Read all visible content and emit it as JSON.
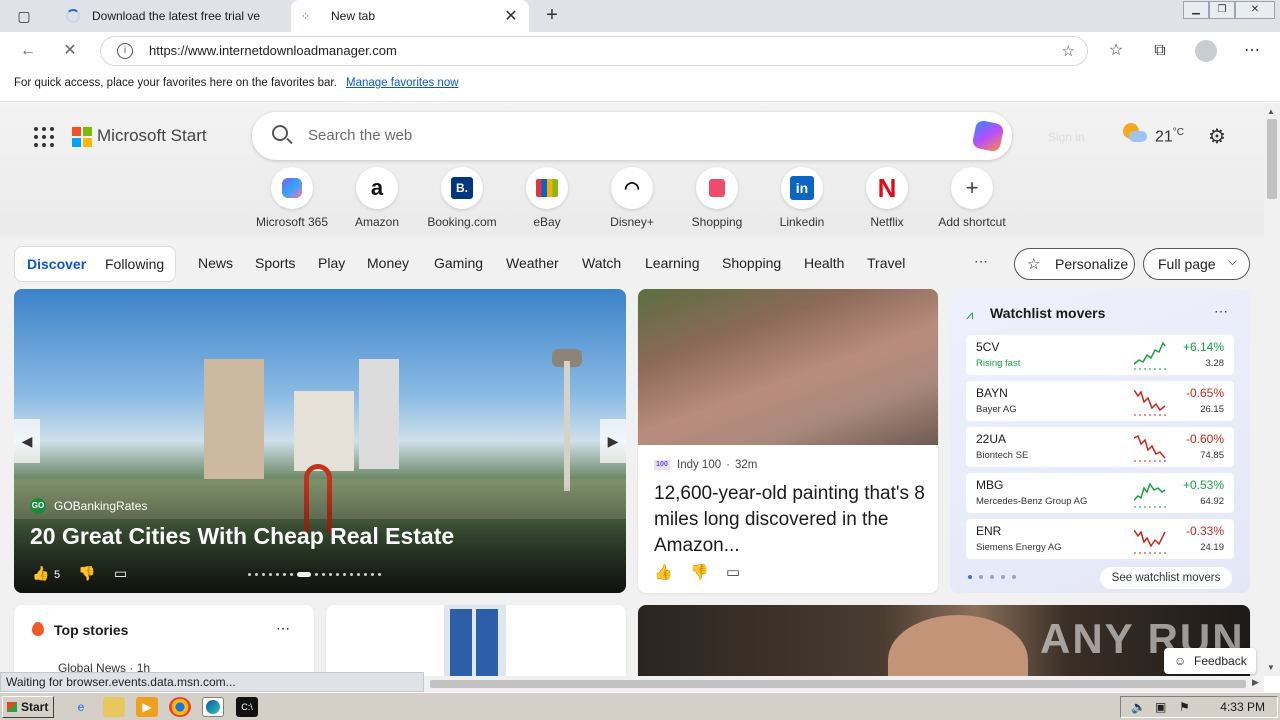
{
  "browser": {
    "tabs": [
      {
        "title": "Download the latest free trial ve"
      },
      {
        "title": "New tab"
      }
    ],
    "url": "https://www.internetdownloadmanager.com",
    "favorites_bar": {
      "text": "For quick access, place your favorites here on the favorites bar.",
      "link": "Manage favorites now"
    },
    "status": "Waiting for browser.events.data.msn.com..."
  },
  "header": {
    "brand": "Microsoft Start",
    "search_placeholder": "Search the web",
    "signin": "Sign in",
    "temperature": "21",
    "temp_unit": "°C"
  },
  "shortcuts": [
    {
      "label": "Microsoft 365",
      "icon": "microsoft-365-icon"
    },
    {
      "label": "Amazon",
      "icon": "amazon-icon"
    },
    {
      "label": "Booking.com",
      "icon": "booking-icon"
    },
    {
      "label": "eBay",
      "icon": "ebay-icon"
    },
    {
      "label": "Disney+",
      "icon": "disney-plus-icon"
    },
    {
      "label": "Shopping",
      "icon": "shopping-bag-icon"
    },
    {
      "label": "Linkedin",
      "icon": "linkedin-icon"
    },
    {
      "label": "Netflix",
      "icon": "netflix-icon"
    },
    {
      "label": "Add shortcut",
      "icon": "plus-icon"
    }
  ],
  "feed": {
    "tabs": [
      "Discover",
      "Following"
    ],
    "categories": [
      "News",
      "Sports",
      "Play",
      "Money",
      "Gaming",
      "Weather",
      "Watch",
      "Learning",
      "Shopping",
      "Health",
      "Travel"
    ],
    "personalize": "Personalize",
    "layout": "Full page"
  },
  "hero": {
    "source": "GOBankingRates",
    "headline": "20 Great Cities With Cheap Real Estate",
    "likes": "5"
  },
  "story": {
    "source": "Indy 100",
    "age": "32m",
    "headline": "12,600-year-old painting that's 8 miles long discovered in the Amazon..."
  },
  "watchlist": {
    "title": "Watchlist movers",
    "see_all": "See watchlist movers",
    "stocks": [
      {
        "symbol": "5CV",
        "name": "Rising fast",
        "change": "+6.14%",
        "price": "3.28",
        "color": "#1a9b4a"
      },
      {
        "symbol": "BAYN",
        "name": "Bayer AG",
        "change": "-0.65%",
        "price": "26.15",
        "color": "#c5281c"
      },
      {
        "symbol": "22UA",
        "name": "Biontech SE",
        "change": "-0.60%",
        "price": "74.85",
        "color": "#c5281c"
      },
      {
        "symbol": "MBG",
        "name": "Mercedes-Benz Group AG",
        "change": "+0.53%",
        "price": "64.92",
        "color": "#1a9b4a"
      },
      {
        "symbol": "ENR",
        "name": "Siemens Energy AG",
        "change": "-0.33%",
        "price": "24.19",
        "color": "#c5281c"
      }
    ]
  },
  "top_stories": {
    "title": "Top stories",
    "source": "Global News · 1h"
  },
  "watermark": "ANY RUN",
  "feedback": "Feedback",
  "taskbar": {
    "start": "Start",
    "time": "4:33 PM"
  },
  "colors": {
    "accent": "#0b57d0",
    "positive": "#1a9b4a",
    "negative": "#c5281c"
  }
}
